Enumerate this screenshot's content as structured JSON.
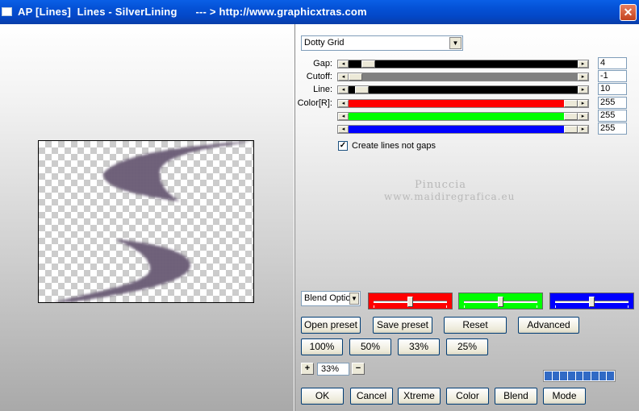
{
  "window": {
    "title": "AP [Lines]  Lines - SilverLining      --- > http://www.graphicxtras.com",
    "close_glyph": "✕"
  },
  "preset_select": {
    "value": "Dotty Grid"
  },
  "sliders": [
    {
      "label": "Gap:",
      "value": "4",
      "color": "#000000",
      "thumb_fraction": 0.06
    },
    {
      "label": "Cutoff:",
      "value": "-1",
      "color": "#808080",
      "thumb_fraction": 0.0
    },
    {
      "label": "Line:",
      "value": "10",
      "color": "#000000",
      "thumb_fraction": 0.03
    },
    {
      "label": "Color[R]:",
      "value": "255",
      "color": "#ff0000",
      "thumb_fraction": 1.0
    },
    {
      "label": "",
      "value": "255",
      "color": "#00ff00",
      "thumb_fraction": 1.0
    },
    {
      "label": "",
      "value": "255",
      "color": "#0000ff",
      "thumb_fraction": 1.0
    }
  ],
  "checkbox": {
    "label": "Create lines not gaps",
    "checked": true,
    "check_glyph": "✓"
  },
  "watermark": {
    "line1": "Pinuccia",
    "line2": "www.maidiregrafica.eu"
  },
  "blend_select": {
    "value": "Blend Optio"
  },
  "color_boxes": [
    {
      "color": "#ff0000",
      "level": 0.5
    },
    {
      "color": "#00ff00",
      "level": 0.5
    },
    {
      "color": "#0000ff",
      "level": 0.5
    }
  ],
  "buttons_row1": [
    "Open preset",
    "Save preset",
    "Reset",
    "Advanced"
  ],
  "zoom_buttons": [
    "100%",
    "50%",
    "33%",
    "25%"
  ],
  "zoom": {
    "plus": "+",
    "value": "33%",
    "minus": "−"
  },
  "progress": {
    "segments": 9
  },
  "bottom_buttons": [
    "OK",
    "Cancel",
    "Xtreme",
    "Color",
    "Blend",
    "Mode"
  ],
  "arrows": {
    "left": "◂",
    "right": "▸",
    "down": "▼"
  },
  "preview": {
    "shape_color": "#5a4a66",
    "dot_color": "#d8cfe0"
  }
}
